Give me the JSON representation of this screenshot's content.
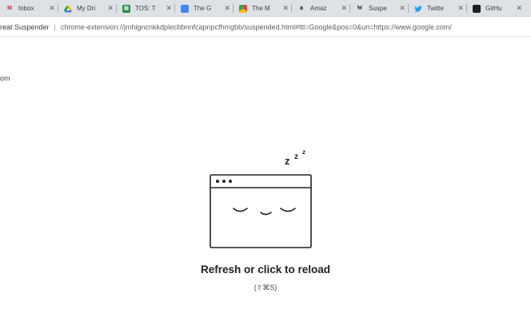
{
  "tabs": [
    {
      "label": "Inbox",
      "icon": "gmail-icon",
      "glyph": "M"
    },
    {
      "label": "My Dri",
      "icon": "google-drive-icon",
      "glyph": ""
    },
    {
      "label": "TOS: T",
      "icon": "sheets-icon",
      "glyph": "▦"
    },
    {
      "label": "The G",
      "icon": "docs-icon",
      "glyph": ""
    },
    {
      "label": "The M",
      "icon": "chrome-icon",
      "glyph": ""
    },
    {
      "label": "Amaz",
      "icon": "amazon-icon",
      "glyph": "a"
    },
    {
      "label": "Suspe",
      "icon": "wikipedia-icon",
      "glyph": "W"
    },
    {
      "label": "Twitte",
      "icon": "twitter-icon",
      "glyph": "🐦"
    },
    {
      "label": "GitHu",
      "icon": "github-icon",
      "glyph": ""
    }
  ],
  "address_bar": {
    "site_name": "reat Suspender",
    "separator": "|",
    "url": "chrome-extension://jmhigncnkkdplecbbnnfcapnpcfhmgbb/suspended.html#ttl=Google&pos=0&uri=https://www.google.com/"
  },
  "page": {
    "stray_text": "om",
    "sleep_text": "z z z",
    "message": "Refresh or click to reload",
    "shortcut": "(⇧⌘S)"
  },
  "colors": {
    "tabstrip_bg": "#dee1e6",
    "text": "#222222",
    "illustration_stroke": "#222222"
  }
}
